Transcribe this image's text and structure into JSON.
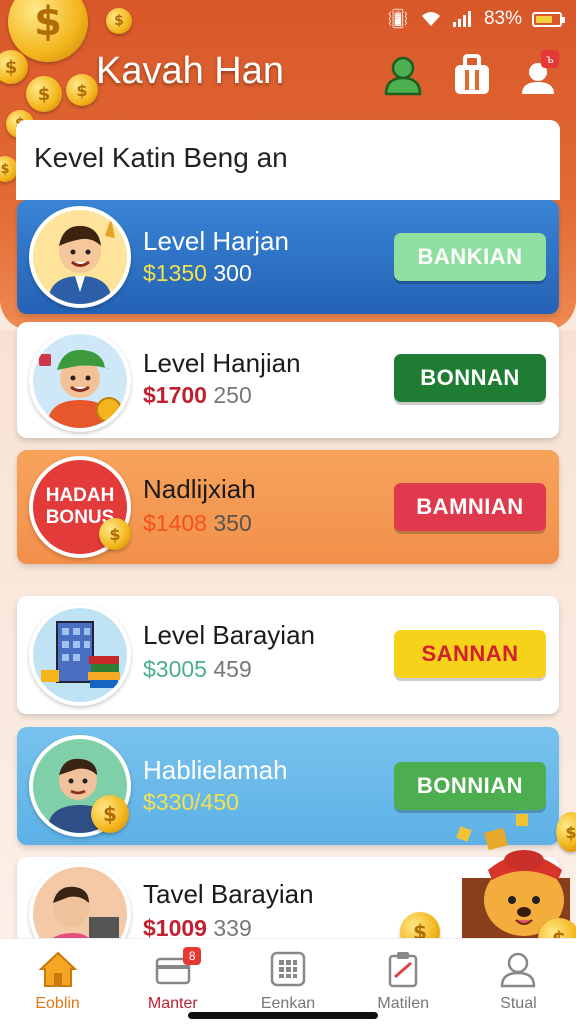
{
  "status_bar": {
    "battery": "83%"
  },
  "header": {
    "title": "Kavah Han",
    "icons": [
      "profile-icon",
      "gift-icon",
      "notification-user-icon"
    ],
    "notification_badge": "ъ"
  },
  "list": {
    "title": "Kevel Katin Beng an"
  },
  "cards": [
    {
      "name": "Level Harjan",
      "price_main": "$1350",
      "price_sub": "300",
      "button": "BANKIAN"
    },
    {
      "name": "Level Hanjian",
      "price_main": "$1700",
      "price_sub": "250",
      "button": "BONNAN"
    },
    {
      "name": "Nadlijxiah",
      "price_main": "$1408",
      "price_sub": "350",
      "button": "BAMNIAN",
      "badge_line1": "HADAH",
      "badge_line2": "BONUS"
    },
    {
      "name": "Level Barayian",
      "price_main": "$3005",
      "price_sub": "459",
      "button": "SANNAN"
    },
    {
      "name": "Hablielamah",
      "price_main": "$330/450",
      "price_sub": "",
      "button": "BONNIAN"
    },
    {
      "name": "Tavel Barayian",
      "price_main": "$1009",
      "price_sub": "339",
      "button": ""
    }
  ],
  "nav": [
    {
      "label": "Eoblin",
      "icon": "home-icon",
      "active": true
    },
    {
      "label": "Manter",
      "icon": "card-icon",
      "badge": "8"
    },
    {
      "label": "Eenkan",
      "icon": "grid-icon"
    },
    {
      "label": "Matilen",
      "icon": "clipboard-icon"
    },
    {
      "label": "Stual",
      "icon": "user-icon"
    }
  ],
  "colors": {
    "header": "#d8572a",
    "accent_green": "#1e7d32",
    "accent_red": "#e0384c",
    "accent_yellow": "#f7d21a",
    "blue_card": "#2e6fbf"
  }
}
